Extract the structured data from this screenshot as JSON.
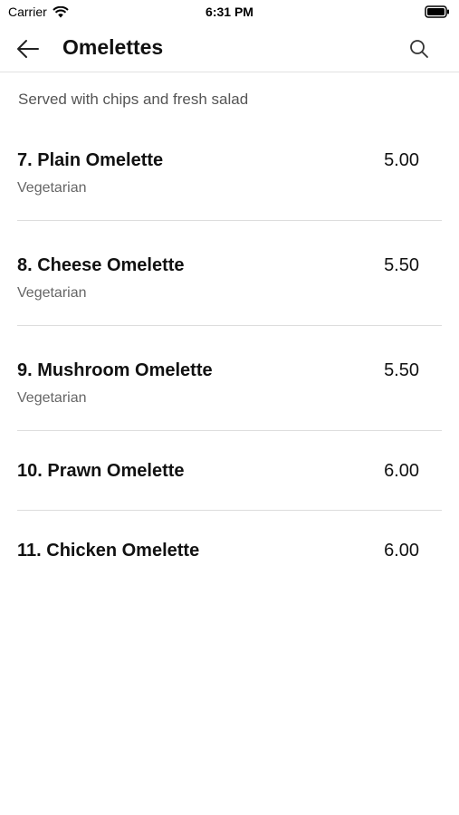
{
  "status_bar": {
    "carrier": "Carrier",
    "time": "6:31 PM"
  },
  "header": {
    "title": "Omelettes",
    "back_icon": "arrow-left-icon",
    "search_icon": "search-icon"
  },
  "subtitle": "Served with chips and fresh salad",
  "items": [
    {
      "name": "7. Plain Omelette",
      "price": "5.00",
      "tag": "Vegetarian"
    },
    {
      "name": "8. Cheese Omelette",
      "price": "5.50",
      "tag": "Vegetarian"
    },
    {
      "name": "9. Mushroom Omelette",
      "price": "5.50",
      "tag": "Vegetarian"
    },
    {
      "name": "10. Prawn Omelette",
      "price": "6.00",
      "tag": ""
    },
    {
      "name": "11. Chicken Omelette",
      "price": "6.00",
      "tag": ""
    }
  ]
}
